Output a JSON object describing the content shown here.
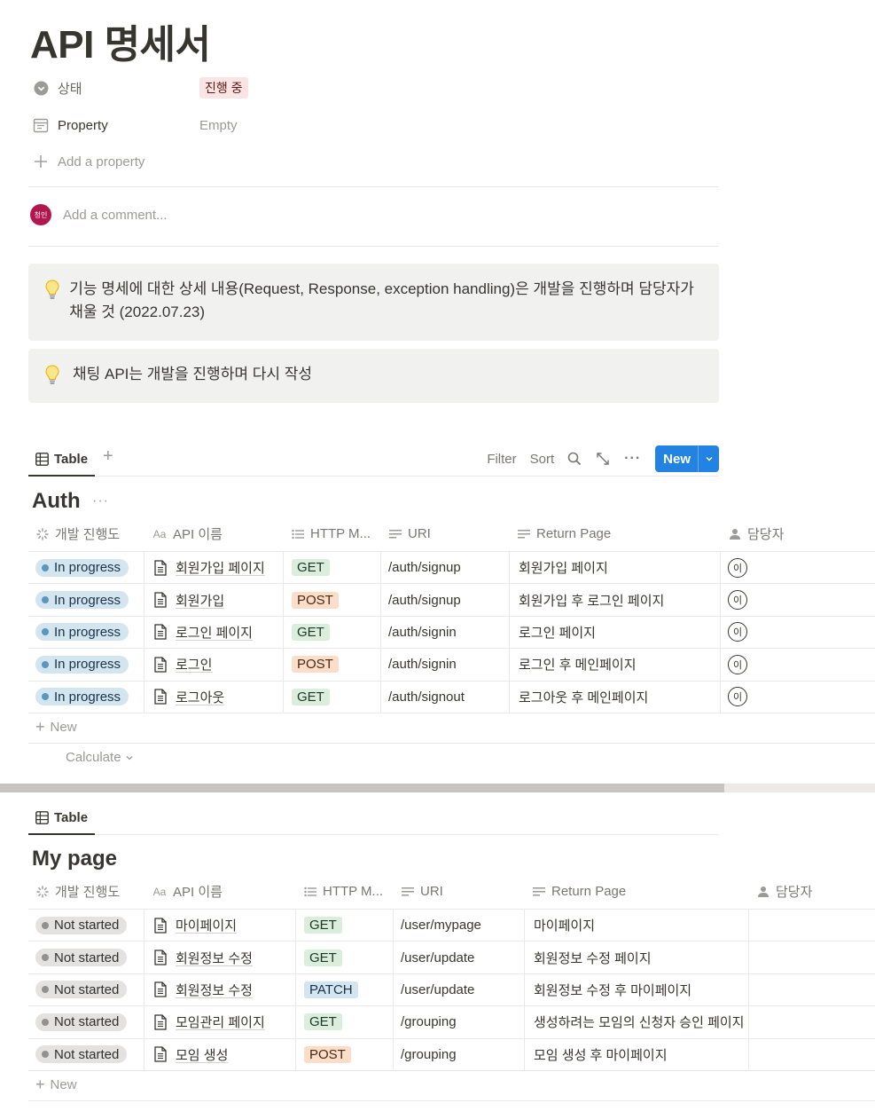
{
  "page": {
    "title": "API 명세서"
  },
  "properties": [
    {
      "name": "상태",
      "icon": "status-icon",
      "value": "진행 중"
    },
    {
      "name": "Property",
      "icon": "calendar-icon",
      "value": "Empty"
    }
  ],
  "add_property_label": "Add a property",
  "comment": {
    "avatar_text": "청인",
    "placeholder": "Add a comment..."
  },
  "callouts": [
    {
      "icon": "lightbulb-icon",
      "text": "기능 명세에 대한 상세 내용(Request, Response, exception handling)은 개발을 진행하며 담당자가 채울 것 (2022.07.23)"
    },
    {
      "icon": "lightbulb-icon",
      "text": "채팅 API는 개발을 진행하며 다시 작성"
    }
  ],
  "toolbar": {
    "filter": "Filter",
    "sort": "Sort",
    "new": "New"
  },
  "tables": [
    {
      "view_label": "Table",
      "title": "Auth",
      "columns": [
        "개발 진행도",
        "API 이름",
        "HTTP M...",
        "URI",
        "Return Page",
        "담당자"
      ],
      "rows": [
        {
          "status": "In progress",
          "name": "회원가입 페이지",
          "method": "GET",
          "uri": "/auth/signup",
          "return_page": "회원가입 페이지",
          "owner": "이"
        },
        {
          "status": "In progress",
          "name": "회원가입",
          "method": "POST",
          "uri": "/auth/signup",
          "return_page": "회원가입 후 로그인 페이지",
          "owner": "이"
        },
        {
          "status": "In progress",
          "name": "로그인 페이지",
          "method": "GET",
          "uri": "/auth/signin",
          "return_page": "로그인 페이지",
          "owner": "이"
        },
        {
          "status": "In progress",
          "name": "로그인",
          "method": "POST",
          "uri": "/auth/signin",
          "return_page": "로그인 후 메인페이지",
          "owner": "이"
        },
        {
          "status": "In progress",
          "name": "로그아웃",
          "method": "GET",
          "uri": "/auth/signout",
          "return_page": "로그아웃 후 메인페이지",
          "owner": "이"
        }
      ],
      "new_label": "New",
      "calculate_label": "Calculate"
    },
    {
      "view_label": "Table",
      "title": "My page",
      "columns": [
        "개발 진행도",
        "API 이름",
        "HTTP M...",
        "URI",
        "Return Page",
        "담당자"
      ],
      "rows": [
        {
          "status": "Not started",
          "name": "마이페이지",
          "method": "GET",
          "uri": "/user/mypage",
          "return_page": "마이페이지",
          "owner": ""
        },
        {
          "status": "Not started",
          "name": "회원정보 수정",
          "method": "GET",
          "uri": "/user/update",
          "return_page": "회원정보 수정 페이지",
          "owner": ""
        },
        {
          "status": "Not started",
          "name": "회원정보 수정",
          "method": "PATCH",
          "uri": "/user/update",
          "return_page": "회원정보 수정 후 마이페이지",
          "owner": ""
        },
        {
          "status": "Not started",
          "name": "모임관리 페이지",
          "method": "GET",
          "uri": "/grouping",
          "return_page": "생성하려는 모임의 신청자 승인 페이지",
          "owner": ""
        },
        {
          "status": "Not started",
          "name": "모임 생성",
          "method": "POST",
          "uri": "/grouping",
          "return_page": "모임 생성 후 마이페이지",
          "owner": ""
        }
      ],
      "new_label": "New"
    }
  ],
  "colors": {
    "accent": "#2383e2",
    "status_tag_bg": "#fbe4e4",
    "in_progress": "#d3e5ef",
    "not_started": "#e3e2e0",
    "get": "#dbeddb",
    "post": "#fadec9",
    "patch": "#d3e5ef"
  }
}
